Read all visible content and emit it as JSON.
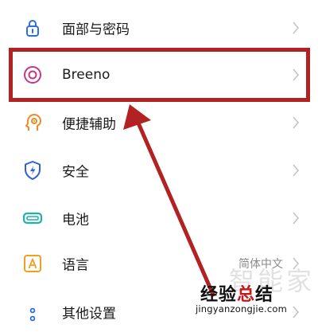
{
  "settings": {
    "items": [
      {
        "label": "面部与密码",
        "icon": "lock-icon",
        "value": ""
      },
      {
        "label": "Breeno",
        "icon": "breeno-ring-icon",
        "value": ""
      },
      {
        "label": "便捷辅助",
        "icon": "head-assist-icon",
        "value": ""
      },
      {
        "label": "安全",
        "icon": "shield-bolt-icon",
        "value": ""
      },
      {
        "label": "电池",
        "icon": "battery-icon",
        "value": ""
      },
      {
        "label": "语言",
        "icon": "language-a-icon",
        "value": "简体中文"
      },
      {
        "label": "其他设置",
        "icon": "more-dots-icon",
        "value": ""
      }
    ]
  },
  "colors": {
    "highlight_red": "#b22222",
    "lock_blue": "#2f6fd6",
    "breeno_pink": "#c2378a",
    "assist_orange": "#f08a24",
    "shield_blue": "#2f5fd6",
    "battery_teal": "#20b2aa",
    "language_orange": "#f0a020"
  },
  "watermark": {
    "background_text": "智能家",
    "main_text_part1": "经验",
    "main_text_accent": "总",
    "main_text_part2": "结",
    "url": "jingyanzongjie.com"
  }
}
